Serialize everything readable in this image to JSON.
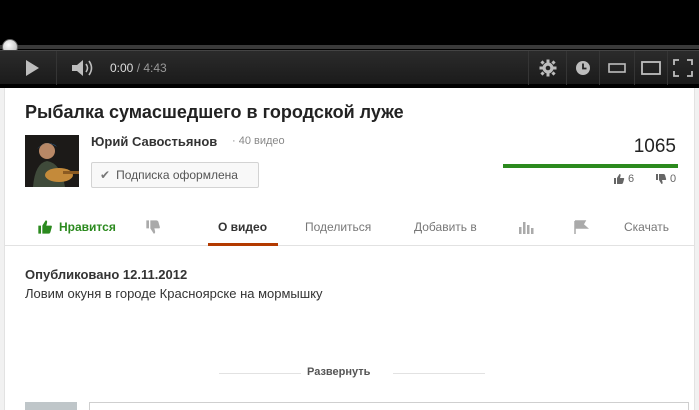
{
  "player": {
    "time_current": "0:00",
    "time_separator": " / ",
    "time_duration": "4:43",
    "progress": 0.0,
    "icons": [
      "play-icon",
      "volume-icon",
      "settings-gear-icon",
      "watch-later-clock-icon",
      "small-player-icon",
      "large-player-icon",
      "fullscreen-icon"
    ]
  },
  "video": {
    "title": "Рыбалка сумасшедшего в городской луже",
    "channel_name": "Юрий Савостьянов",
    "video_count": "· 40 видео",
    "subscribe_label": "Подписка оформлена",
    "views": "1065",
    "likes": "6",
    "dislikes": "0",
    "like_ratio": 1.0
  },
  "tabs": {
    "like": "Нравится",
    "about": "О видео",
    "share": "Поделиться",
    "add_to": "Добавить в",
    "download": "Скачать"
  },
  "description": {
    "published": "Опубликовано 12.11.2012",
    "text": "Ловим окуня в городе Красноярске на мормышку",
    "expand_label": "Развернуть"
  },
  "colors": {
    "accent_green": "#2b8a1e",
    "active_tab_underline": "#b33a00",
    "player_bg": "#000000"
  }
}
